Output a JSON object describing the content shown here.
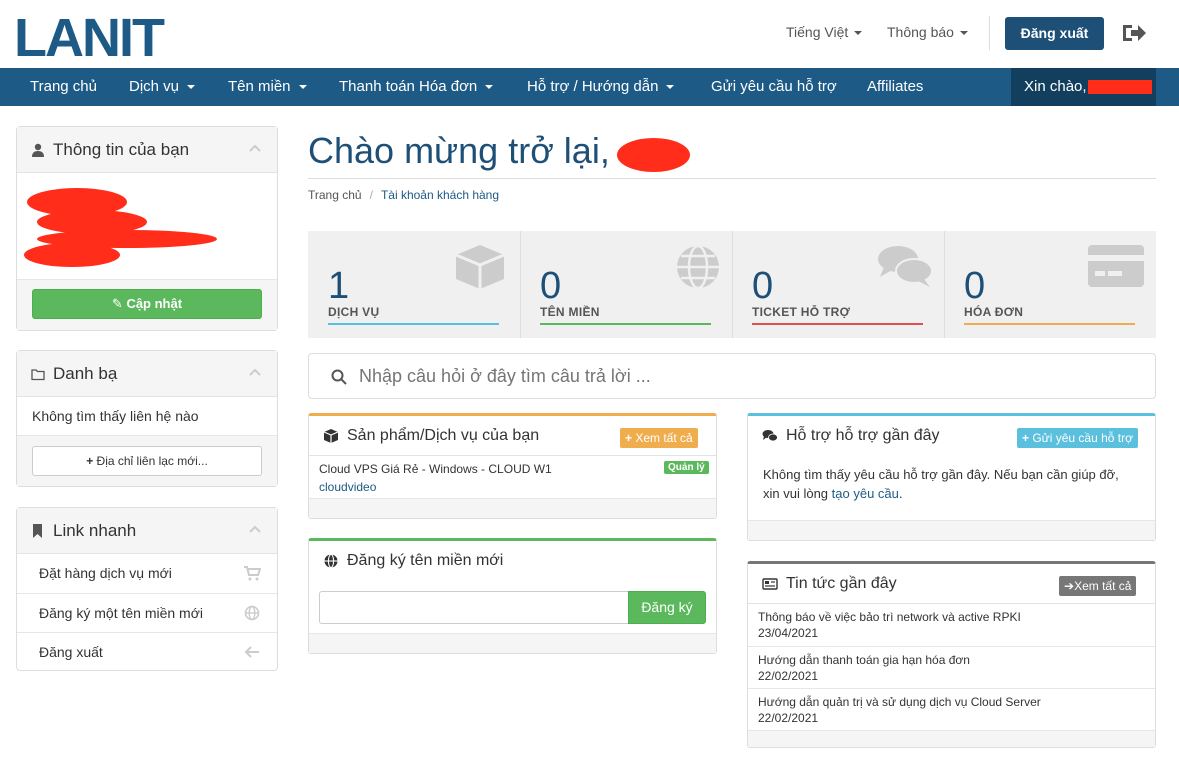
{
  "header": {
    "logo_text": "LANIT",
    "language_label": "Tiếng Việt",
    "notifications_label": "Thông báo",
    "logout_label": "Đăng xuất"
  },
  "nav": {
    "items": [
      {
        "label": "Trang chủ",
        "dropdown": false
      },
      {
        "label": "Dịch vụ",
        "dropdown": true
      },
      {
        "label": "Tên miền",
        "dropdown": true
      },
      {
        "label": "Thanh toán Hóa đơn",
        "dropdown": true
      },
      {
        "label": "Hỗ trợ / Hướng dẫn",
        "dropdown": true
      },
      {
        "label": "Gửi yêu cầu hỗ trợ",
        "dropdown": false
      },
      {
        "label": "Affiliates",
        "dropdown": false
      }
    ],
    "greeting": "Xin chào,"
  },
  "sidebar": {
    "info": {
      "title": "Thông tin của bạn",
      "update_button": "Cập nhật"
    },
    "contacts": {
      "title": "Danh bạ",
      "empty_text": "Không tìm thấy liên hệ nào",
      "new_button": "Địa chỉ liên lạc mới..."
    },
    "quicklinks": {
      "title": "Link nhanh",
      "items": [
        {
          "label": "Đặt hàng dịch vụ mới",
          "icon": "cart-icon"
        },
        {
          "label": "Đăng ký một tên miền mới",
          "icon": "globe-icon"
        },
        {
          "label": "Đăng xuất",
          "icon": "arrow-left-icon"
        }
      ]
    }
  },
  "main": {
    "title": "Chào mừng trở lại,",
    "breadcrumb": {
      "home": "Trang chủ",
      "separator": "/",
      "current": "Tài khoản khách hàng"
    },
    "tiles": [
      {
        "value": "1",
        "label": "DỊCH VỤ",
        "color": "#5bc0de",
        "icon": "cube-icon"
      },
      {
        "value": "0",
        "label": "TÊN MIỀN",
        "color": "#5cb85c",
        "icon": "globe-icon"
      },
      {
        "value": "0",
        "label": "TICKET HỖ TRỢ",
        "color": "#d9534f",
        "icon": "comments-icon"
      },
      {
        "value": "0",
        "label": "HÓA ĐƠN",
        "color": "#f0ad4e",
        "icon": "credit-card-icon"
      }
    ],
    "search_placeholder": "Nhập câu hỏi ở đây tìm câu trả lời ...",
    "products": {
      "title": "Sản phẩm/Dịch vụ của bạn",
      "view_all": "Xem tất cả",
      "accent": "#f0ad4e",
      "item_name": "Cloud VPS Giá Rẻ - Windows - CLOUD W1",
      "item_domain": "cloudvideo",
      "item_badge": "Quản lý"
    },
    "domain_register": {
      "title": "Đăng ký tên miền mới",
      "button": "Đăng ký",
      "accent": "#5cb85c"
    },
    "support": {
      "title": "Hỗ trợ hỗ trợ gần đây",
      "button": "Gửi yêu cầu hỗ trợ",
      "accent": "#5bc0de",
      "empty_text": "Không tìm thấy yêu cầu hỗ trợ gần đây. Nếu bạn cần giúp đỡ,",
      "empty_text_2": "xin vui lòng",
      "link": "tạo yêu cầu",
      "period": "."
    },
    "news": {
      "title": "Tin tức gần đây",
      "view_all": "Xem tất cả",
      "accent": "#777777",
      "items": [
        {
          "title": "Thông báo về việc bảo trì network và active RPKI",
          "date": "23/04/2021"
        },
        {
          "title": "Hướng dẫn thanh toán gia hạn hóa đơn",
          "date": "22/02/2021"
        },
        {
          "title": "Hướng dẫn quản trị và sử dụng dịch vụ Cloud Server",
          "date": "22/02/2021"
        }
      ]
    }
  }
}
